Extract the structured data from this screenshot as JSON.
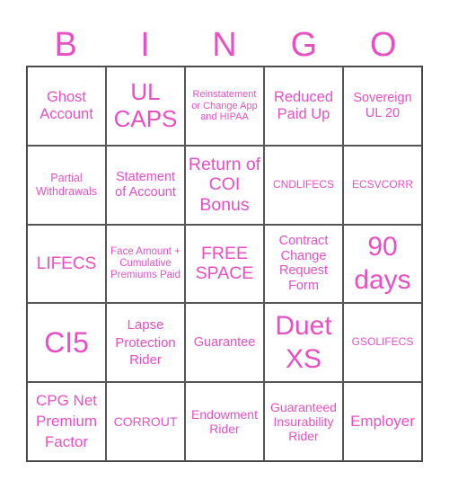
{
  "header": {
    "letters": [
      "B",
      "I",
      "N",
      "G",
      "O"
    ]
  },
  "accent_color": "#e84fc4",
  "cells": [
    "Ghost Account",
    "UL CAPS",
    "Reinstatement or Change App and HIPAA",
    "Reduced Paid Up",
    "Sovereign UL 20",
    "Partial Withdrawals",
    "Statement of Account",
    "Return of COI Bonus",
    "CNDLIFECS",
    "ECSVCORR",
    "LIFECS",
    "Face Amount + Cumulative Premiums Paid",
    "FREE SPACE",
    "Contract Change Request Form",
    "90 days",
    "CI5",
    "Lapse Protection Rider",
    "Guarantee",
    "Duet XS",
    "GSOLIFECS",
    "CPG Net Premium Factor",
    "CORROUT",
    "Endowment Rider",
    "Guaranteed Insurability Rider",
    "Employer"
  ]
}
